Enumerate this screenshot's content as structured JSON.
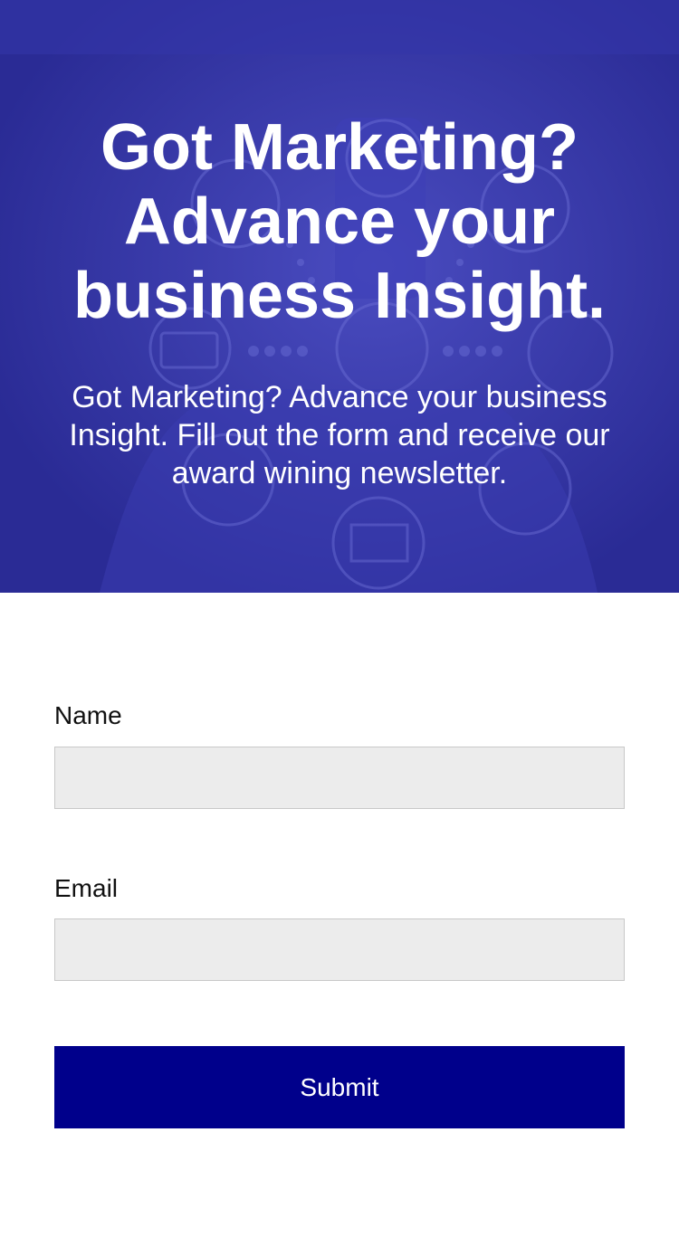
{
  "hero": {
    "title": "Got Marketing? Advance your business Insight.",
    "subtitle": "Got Marketing? Advance your business Insight. Fill out the form and receive our award wining newsletter.",
    "overlay_color": "#2e2f9e"
  },
  "form": {
    "name_label": "Name",
    "name_value": "",
    "email_label": "Email",
    "email_value": "",
    "submit_label": "Submit",
    "submit_color": "#00008b",
    "input_bg": "#ececec"
  }
}
